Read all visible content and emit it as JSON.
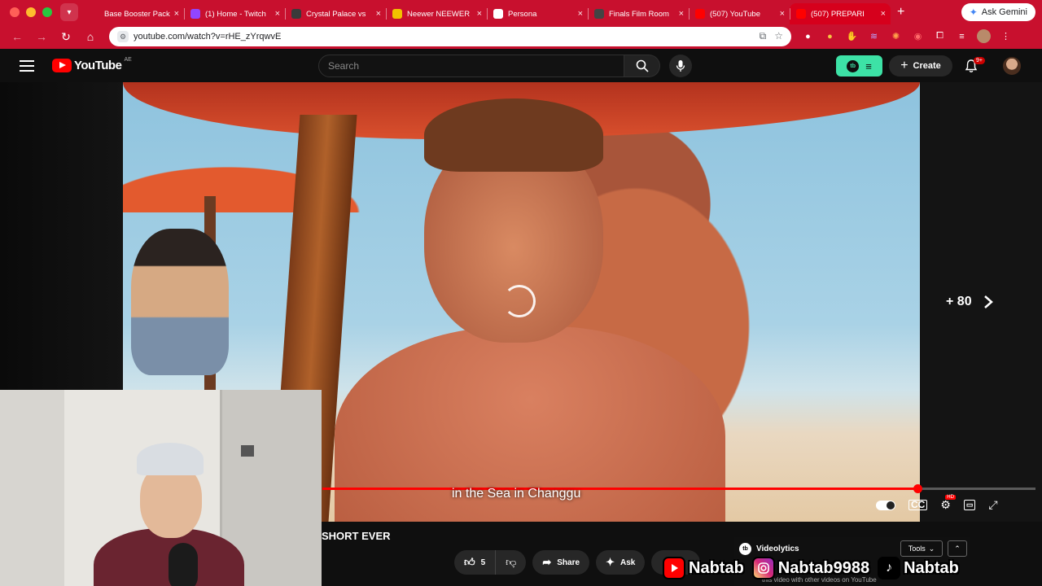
{
  "browser": {
    "tabs": [
      {
        "title": "Base Booster Pack",
        "fav_color": "#c8102e"
      },
      {
        "title": "(1) Home - Twitch",
        "fav_color": "#9146ff"
      },
      {
        "title": "Crystal Palace vs",
        "fav_color": "#3a3a3a"
      },
      {
        "title": "Neewer NEEWER",
        "fav_color": "#f2c200"
      },
      {
        "title": "Persona",
        "fav_color": "#ffffff"
      },
      {
        "title": "Finals Film Room",
        "fav_color": "#444444"
      },
      {
        "title": "(507) YouTube",
        "fav_color": "#ff0000"
      },
      {
        "title": "(507) PREPARI",
        "fav_color": "#ff0000",
        "active": true
      }
    ],
    "gemini_label": "Ask Gemini",
    "url": "youtube.com/watch?v=rHE_zYrqwvE",
    "theme_color": "#c8102e"
  },
  "youtube": {
    "logo_text": "YouTube",
    "country_code": "AE",
    "search_placeholder": "Search",
    "create_label": "Create",
    "notifications_badge": "9+"
  },
  "player": {
    "skip_label": "+ 80",
    "caption": "in the Sea in Changgu",
    "progress": 0.835
  },
  "video": {
    "title": "SHORT EVER",
    "likes": "5",
    "share_label": "Share",
    "ask_label": "Ask"
  },
  "videolytics": {
    "name": "Videolytics",
    "tools_label": "Tools",
    "text": "this video with other videos on YouTube"
  },
  "socials": {
    "youtube": "Nabtab",
    "instagram": "Nabtab9988",
    "tiktok": "Nabtab"
  }
}
